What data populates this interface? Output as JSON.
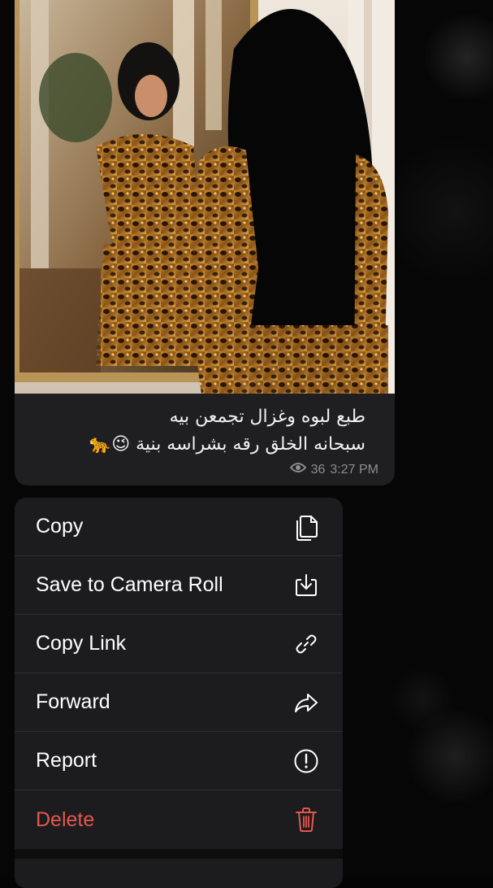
{
  "message": {
    "caption_line1": "طبع لبوه وغزال تجمعن بيه",
    "caption_line2": "سبحانه الخلق رقه بشراسه بنية 😉🐆",
    "views": "36",
    "time": "3:27 PM",
    "views_icon": "eye-icon"
  },
  "menu": {
    "items": [
      {
        "label": "Copy",
        "icon": "copy-icon"
      },
      {
        "label": "Save to Camera Roll",
        "icon": "save-download-icon"
      },
      {
        "label": "Copy Link",
        "icon": "link-icon"
      },
      {
        "label": "Forward",
        "icon": "forward-arrow-icon"
      },
      {
        "label": "Report",
        "icon": "exclamation-circle-icon"
      },
      {
        "label": "Delete",
        "icon": "trash-icon"
      }
    ]
  },
  "colors": {
    "menu_bg": "#1c1c1e",
    "bubble_bg": "#1f1f21",
    "delete_red": "#e5574d",
    "meta_gray": "#8e8e93"
  }
}
